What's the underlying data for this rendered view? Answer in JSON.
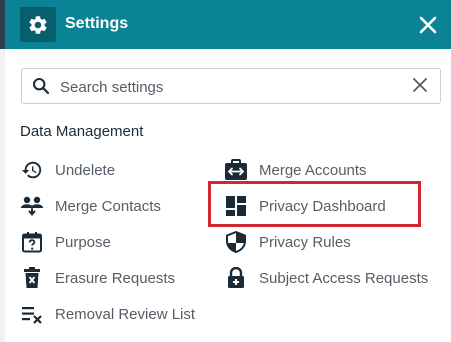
{
  "header": {
    "title": "Settings",
    "close_label": "✕"
  },
  "search": {
    "placeholder": "Search settings"
  },
  "section": {
    "title": "Data Management"
  },
  "items": {
    "undelete": "Undelete",
    "merge_contacts": "Merge Contacts",
    "purpose": "Purpose",
    "erasure_requests": "Erasure Requests",
    "removal_review_list": "Removal Review List",
    "merge_accounts": "Merge Accounts",
    "privacy_dashboard": "Privacy Dashboard",
    "privacy_rules": "Privacy Rules",
    "subject_access_requests": "Subject Access Requests"
  },
  "colors": {
    "header": "#0b8396",
    "gear_box": "#075f6d",
    "icon": "#1b2a35",
    "label": "#555d66",
    "highlight": "#d22630"
  }
}
